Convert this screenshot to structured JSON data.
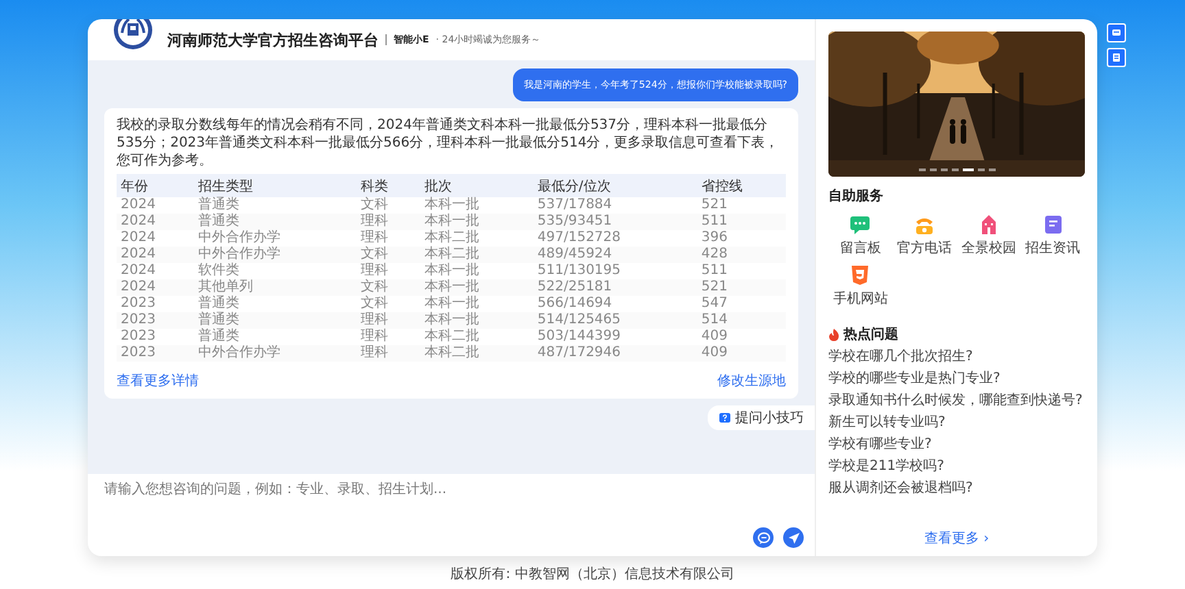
{
  "header": {
    "title": "河南师范大学官方招生咨询平台",
    "assistant": "智能小E",
    "slogan": "· 24小时竭诚为您服务～"
  },
  "chat": {
    "user_message": "我是河南的学生，今年考了524分，想报你们学校能被录取吗?",
    "answer": "我校的录取分数线每年的情况会稍有不同，2024年普通类文科本科一批最低分537分，理科本科一批最低分535分；2023年普通类文科本科一批最低分566分，理科本科一批最低分514分，更多录取信息可查看下表，您可作为参考。",
    "table": {
      "columns": [
        "年份",
        "招生类型",
        "科类",
        "批次",
        "最低分/位次",
        "省控线"
      ],
      "rows": [
        [
          "2024",
          "普通类",
          "文科",
          "本科一批",
          "537/17884",
          "521"
        ],
        [
          "2024",
          "普通类",
          "理科",
          "本科一批",
          "535/93451",
          "511"
        ],
        [
          "2024",
          "中外合作办学",
          "理科",
          "本科二批",
          "497/152728",
          "396"
        ],
        [
          "2024",
          "中外合作办学",
          "文科",
          "本科二批",
          "489/45924",
          "428"
        ],
        [
          "2024",
          "软件类",
          "理科",
          "本科一批",
          "511/130195",
          "511"
        ],
        [
          "2024",
          "其他单列",
          "文科",
          "本科一批",
          "522/25181",
          "521"
        ],
        [
          "2023",
          "普通类",
          "文科",
          "本科一批",
          "566/14694",
          "547"
        ],
        [
          "2023",
          "普通类",
          "理科",
          "本科一批",
          "514/125465",
          "514"
        ],
        [
          "2023",
          "普通类",
          "理科",
          "本科二批",
          "503/144399",
          "409"
        ],
        [
          "2023",
          "中外合作办学",
          "理科",
          "本科二批",
          "487/172946",
          "409"
        ]
      ]
    },
    "more_link": "查看更多详情",
    "edit_link": "修改生源地",
    "tips_button": "提问小技巧"
  },
  "input": {
    "placeholder": "请输入您想咨询的问题，例如：专业、录取、招生计划..."
  },
  "carousel": {
    "dots": [
      {
        "selected": false
      },
      {
        "selected": false
      },
      {
        "selected": false
      },
      {
        "selected": false
      },
      {
        "selected": true
      },
      {
        "selected": false
      },
      {
        "selected": false
      }
    ]
  },
  "services": {
    "title": "自助服务",
    "items": [
      {
        "kind": "board",
        "label": "留言板"
      },
      {
        "kind": "phone",
        "label": "官方电话"
      },
      {
        "kind": "campus",
        "label": "全景校园"
      },
      {
        "kind": "news",
        "label": "招生资讯"
      },
      {
        "kind": "mobile",
        "label": "手机网站"
      }
    ]
  },
  "hot": {
    "title": "热点问题",
    "questions": [
      "学校在哪几个批次招生?",
      "学校的哪些专业是热门专业?",
      "录取通知书什么时候发，哪能查到快递号?",
      "新生可以转专业吗?",
      "学校有哪些专业?",
      "学校是211学校吗?",
      "服从调剂还会被退档吗?"
    ],
    "more": "查看更多 ›"
  },
  "footer": "版权所有: 中教智网（北京）信息技术有限公司"
}
